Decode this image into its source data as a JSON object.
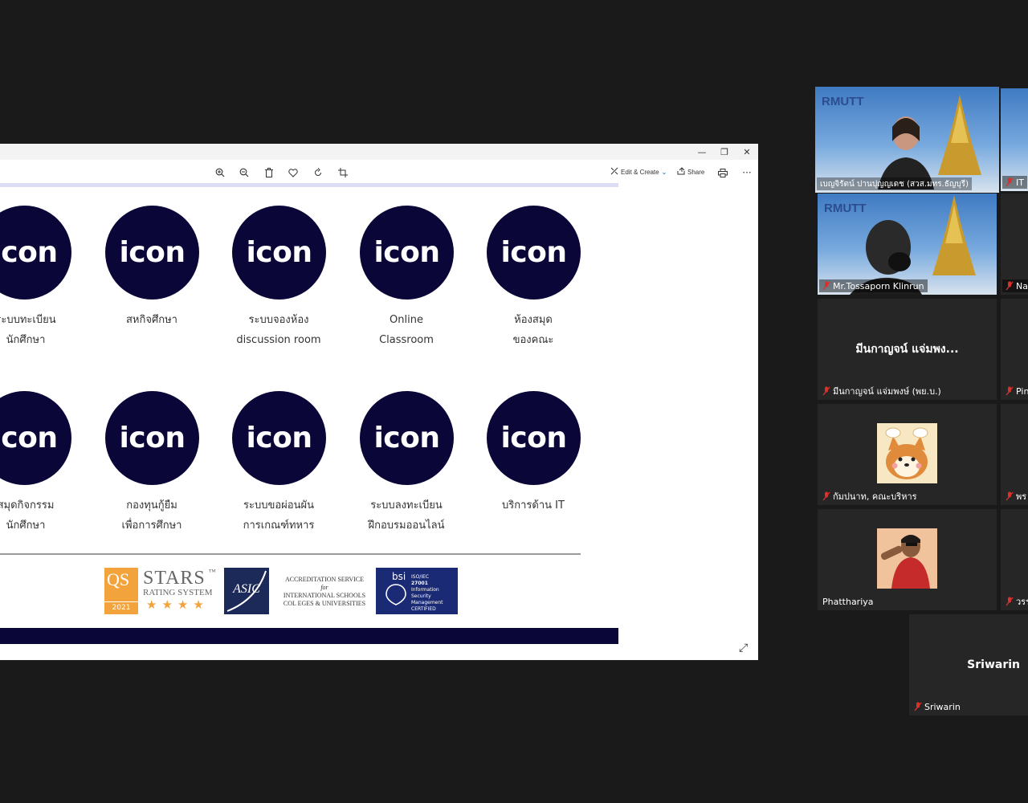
{
  "toolbar": {
    "edit_create": "Edit & Create",
    "share": "Share"
  },
  "slide": {
    "icon_text": "icon",
    "row1": [
      {
        "line1": "ระบบทะเบียน",
        "line2": "นักศึกษา"
      },
      {
        "line1": "สหกิจศึกษา",
        "line2": ""
      },
      {
        "line1": "ระบบจองห้อง",
        "line2": "discussion room"
      },
      {
        "line1": "Online",
        "line2": "Classroom"
      },
      {
        "line1": "ห้องสมุด",
        "line2": "ของคณะ"
      }
    ],
    "row2": [
      {
        "line1": "สมุดกิจกรรม",
        "line2": "นักศึกษา"
      },
      {
        "line1": "กองทุนกู้ยืม",
        "line2": "เพื่อการศึกษา"
      },
      {
        "line1": "ระบบขอผ่อนผัน",
        "line2": "การเกณฑ์ทหาร"
      },
      {
        "line1": "ระบบลงทะเบียน",
        "line2": "ฝึกอบรมออนไลน์"
      },
      {
        "line1": "บริการด้าน IT",
        "line2": ""
      }
    ],
    "logos": {
      "qs": "QS",
      "qs_year": "2021",
      "stars": "STARS",
      "tm": "™",
      "rating": "RATING SYSTEM",
      "asic": "ASIC",
      "asic_l1": "ACCREDITATION SERVICE",
      "asic_l2": "for",
      "asic_l3": "INTERNATIONAL SCHOOLS",
      "asic_l4": "COL EGES & UNIVERSITIES",
      "bsi": "bsi",
      "bsi_l1": "ISO/IEC",
      "bsi_l2": "27001",
      "bsi_l3": "Information Security",
      "bsi_l4": "Management",
      "bsi_l5": "CERTIFIED"
    }
  },
  "participants": {
    "p1": "เบญจิรัตน์ ปานปุญญเดช (สวส.มทร.ธัญบุรี)",
    "p1_right": "IT",
    "p2": "Mr.Tossaporn Klinrun",
    "p2_right": "Na",
    "p3_center": "มีนกาญจน์ แจ่มพง...",
    "p3": "มีนกาญจน์ แจ่มพงษ์ (พย.บ.)",
    "p3_right": "Pin",
    "p4": "กัมปนาท, คณะบริหาร",
    "p4_right": "พร",
    "p5": "Phatthariya",
    "p5_right": "วรร",
    "p6_center": "Sriwarin",
    "p6": "Sriwarin",
    "logo_text": "RMUTT"
  },
  "colors": {
    "icon_circle": "#0b0638",
    "active_speaker": "#c8e65a",
    "mute": "#d9312b"
  }
}
